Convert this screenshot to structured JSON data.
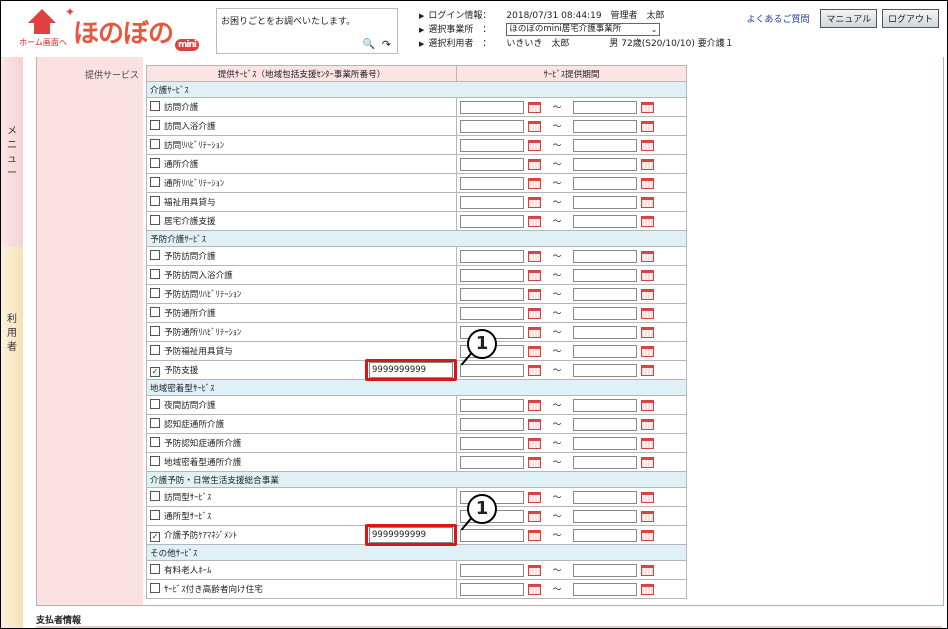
{
  "header": {
    "home_label": "ホーム画面へ",
    "logo_text": "ほのぼの",
    "logo_badge": "mini",
    "help_placeholder": "お困りごとをお調べいたします。",
    "login_info_label": "ログイン情報：",
    "login_info_value": "2018/07/31 08:44:19　管理者　太郎",
    "office_label": "選択事業所　：",
    "office_value": "ほのぼのmini居宅介護事業所",
    "user_label": "選択利用者　：",
    "user_value": "いきいき　太郎",
    "user_detail": "男 72歳(S20/10/10) 要介護１",
    "faq": "よくあるご質問",
    "manual": "マニュアル",
    "logout": "ログアウト"
  },
  "sidebar": {
    "menu": [
      "メ",
      "ニ",
      "ュ",
      "ー"
    ],
    "user": [
      "利",
      "用",
      "者"
    ]
  },
  "form": {
    "label": "提供サービス",
    "col_service": "提供ｻｰﾋﾞｽ（地域包括支援ｾﾝﾀｰ事業所番号）",
    "col_period": "ｻｰﾋﾞｽ提供期間",
    "tilde": "～",
    "rows": [
      {
        "type": "section",
        "label": "介護ｻｰﾋﾞｽ"
      },
      {
        "type": "item",
        "label": "訪問介護",
        "checked": false
      },
      {
        "type": "item",
        "label": "訪問入浴介護",
        "checked": false
      },
      {
        "type": "item",
        "label": "訪問ﾘﾊﾋﾞﾘﾃｰｼｮﾝ",
        "checked": false
      },
      {
        "type": "item",
        "label": "通所介護",
        "checked": false
      },
      {
        "type": "item",
        "label": "通所ﾘﾊﾋﾞﾘﾃｰｼｮﾝ",
        "checked": false
      },
      {
        "type": "item",
        "label": "福祉用具貸与",
        "checked": false
      },
      {
        "type": "item",
        "label": "居宅介護支援",
        "checked": false
      },
      {
        "type": "section",
        "label": "予防介護ｻｰﾋﾞｽ"
      },
      {
        "type": "item",
        "label": "予防訪問介護",
        "checked": false
      },
      {
        "type": "item",
        "label": "予防訪問入浴介護",
        "checked": false
      },
      {
        "type": "item",
        "label": "予防訪問ﾘﾊﾋﾞﾘﾃｰｼｮﾝ",
        "checked": false
      },
      {
        "type": "item",
        "label": "予防通所介護",
        "checked": false
      },
      {
        "type": "item",
        "label": "予防通所ﾘﾊﾋﾞﾘﾃｰｼｮﾝ",
        "checked": false
      },
      {
        "type": "item",
        "label": "予防福祉用具貸与",
        "checked": false
      },
      {
        "type": "item",
        "label": "予防支援",
        "checked": true,
        "code": "9999999999"
      },
      {
        "type": "section",
        "label": "地域密着型ｻｰﾋﾞｽ"
      },
      {
        "type": "item",
        "label": "夜間訪問介護",
        "checked": false
      },
      {
        "type": "item",
        "label": "認知症通所介護",
        "checked": false
      },
      {
        "type": "item",
        "label": "予防認知症通所介護",
        "checked": false
      },
      {
        "type": "item",
        "label": "地域密着型通所介護",
        "checked": false
      },
      {
        "type": "section",
        "label": "介護予防・日常生活支援総合事業"
      },
      {
        "type": "item",
        "label": "訪問型ｻｰﾋﾞｽ",
        "checked": false
      },
      {
        "type": "item",
        "label": "通所型ｻｰﾋﾞｽ",
        "checked": false
      },
      {
        "type": "item",
        "label": "介護予防ｹｱﾏﾈｼﾞﾒﾝﾄ",
        "checked": true,
        "code": "9999999999"
      },
      {
        "type": "section",
        "label": "その他ｻｰﾋﾞｽ"
      },
      {
        "type": "item",
        "label": "有料老人ﾎｰﾑ",
        "checked": false
      },
      {
        "type": "item",
        "label": "ｻｰﾋﾞｽ付き高齢者向け住宅",
        "checked": false
      }
    ]
  },
  "callout_number": "1",
  "footer": {
    "payer_title": "支払者情報"
  }
}
